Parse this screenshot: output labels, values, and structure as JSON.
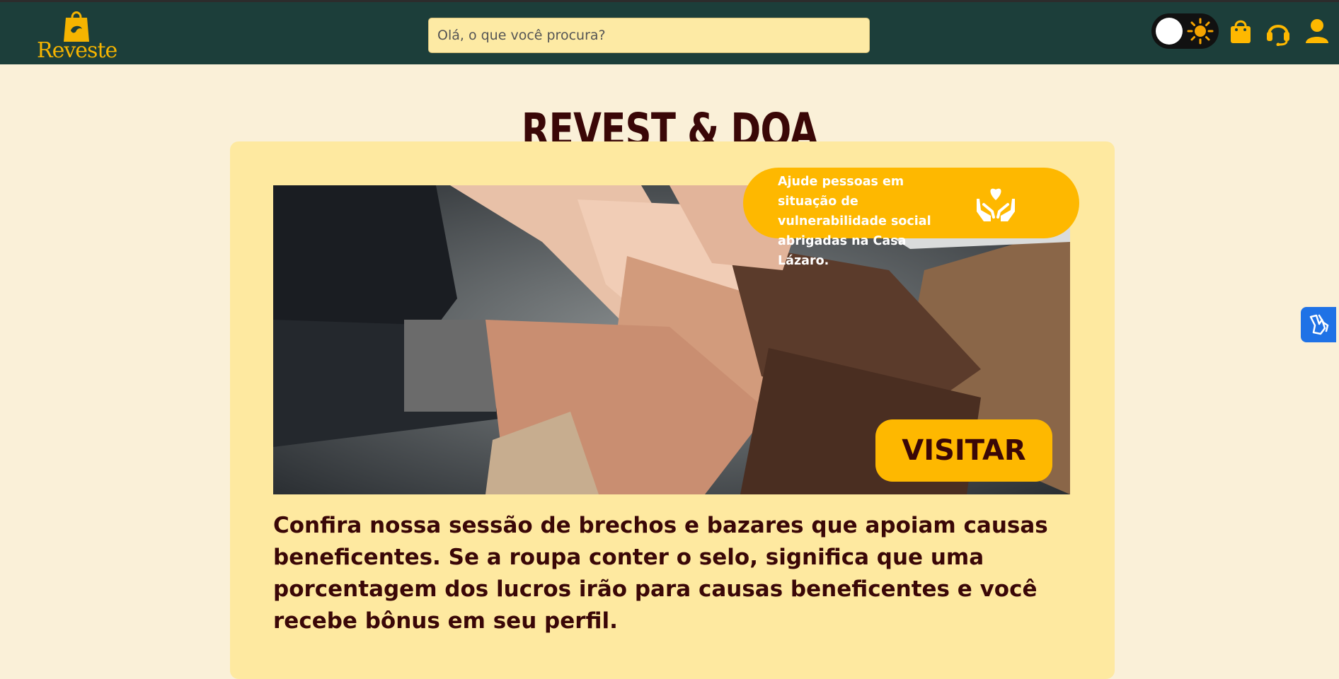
{
  "header": {
    "logo_text": "Reveste",
    "search": {
      "placeholder": "Olá, o que você procura?",
      "value": ""
    },
    "icons": [
      "theme-toggle",
      "sun-icon",
      "shopping-bag-icon",
      "headset-icon",
      "user-icon"
    ]
  },
  "main": {
    "title": "REVEST & DOA",
    "badge_text": "Ajude pessoas em situação de vulnerabilidade social abrigadas na Casa Lázaro.",
    "visit_button": "VISITAR",
    "description": "Confira nossa sessão de brechos e bazares que apoiam causas beneficentes. Se a roupa conter o selo, significa que uma porcentagem dos lucros irão para causas beneficentes e você recebe bônus em seu perfil."
  },
  "colors": {
    "header_bg": "#1c3e3a",
    "page_bg": "#faf0d8",
    "card_bg": "#fee9a0",
    "accent": "#feb800",
    "text_dark": "#3a0707",
    "accessibility_blue": "#1f72e6"
  }
}
